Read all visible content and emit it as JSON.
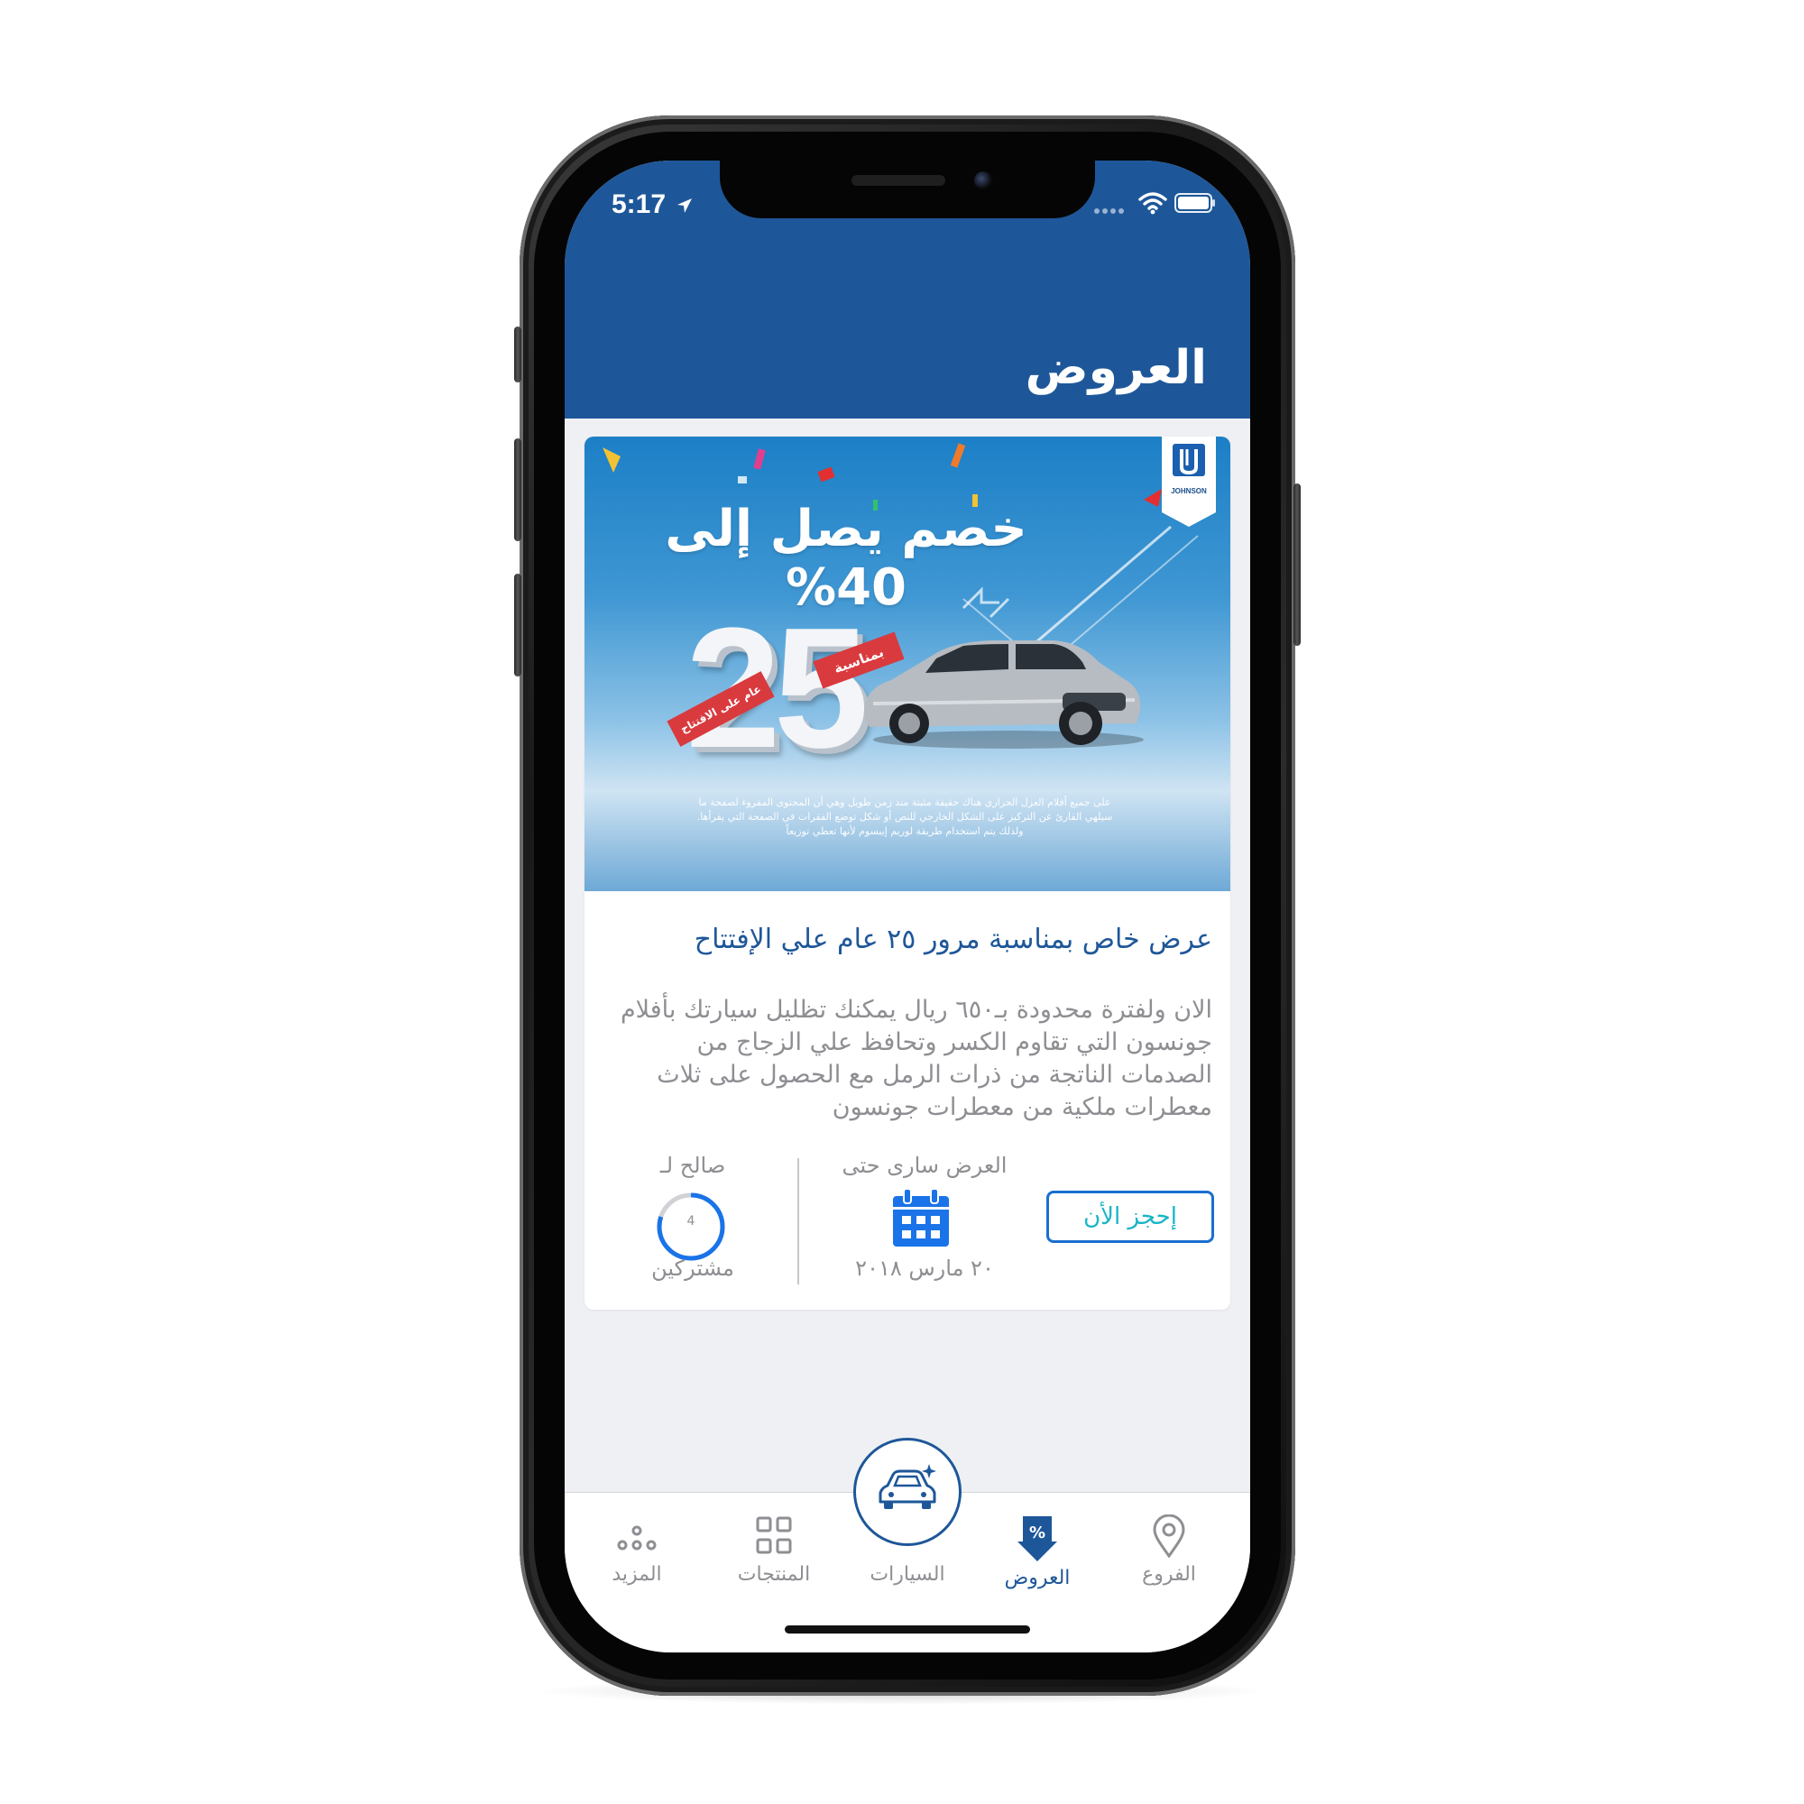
{
  "status_bar": {
    "time": "5:17"
  },
  "header": {
    "title": "العروض"
  },
  "offer": {
    "banner": {
      "brand": "JOHNSON",
      "headline": "خصم يصل إلى 40%",
      "big_number": "25",
      "ribbon_left": "عام على الافتتاح",
      "ribbon_right": "بمناسبة",
      "fine_print": "على جميع أفلام العزل الحراري هناك حقيقة مثبتة منذ زمن طويل وهي أن المحتوى المقروء لصفحة ما سيلهي القارئ عن التركيز على الشكل الخارجي للنص أو شكل توضع الفقرات في الصفحة التي يقرأها. ولذلك يتم استخدام طريقة لوريم إيبسوم لأنها تعطي توزيعاً"
    },
    "title": "عرض خاص بمناسبة مرور ٢٥ عام علي الإفتتاح",
    "description": "الان ولفترة محدودة بـ٦٥٠ ريال يمكنك تظليل سيارتك بأفلام جونسون التي تقاوم الكسر وتحافظ علي الزجاج من الصدمات الناتجة من ذرات الرمل مع الحصول على ثلاث معطرات ملكية من معطرات جونسون",
    "book_button": "إحجز الأن",
    "valid_until_label": "العرض سارى حتى",
    "valid_until_date": "٢٠ مارس ٢٠١٨",
    "valid_for_label": "صالح لـ",
    "subscribers_count": "4",
    "subscribers_fraction": 0.8,
    "subscribers_label": "مشتركين"
  },
  "tabs": [
    {
      "label": "الفروع",
      "icon": "location-pin-icon"
    },
    {
      "label": "العروض",
      "icon": "offers-percent-icon",
      "active": true
    },
    {
      "label": "السيارات",
      "icon": "car-icon"
    },
    {
      "label": "المنتجات",
      "icon": "grid-icon"
    },
    {
      "label": "المزيد",
      "icon": "more-dots-icon"
    }
  ],
  "colors": {
    "primary": "#1e5799",
    "accent_button_border": "#1a6fcf",
    "accent_button_text": "#19b5c5",
    "ring": "#1a73e8",
    "muted_text": "#8e8e93",
    "background": "#eff0f4"
  }
}
